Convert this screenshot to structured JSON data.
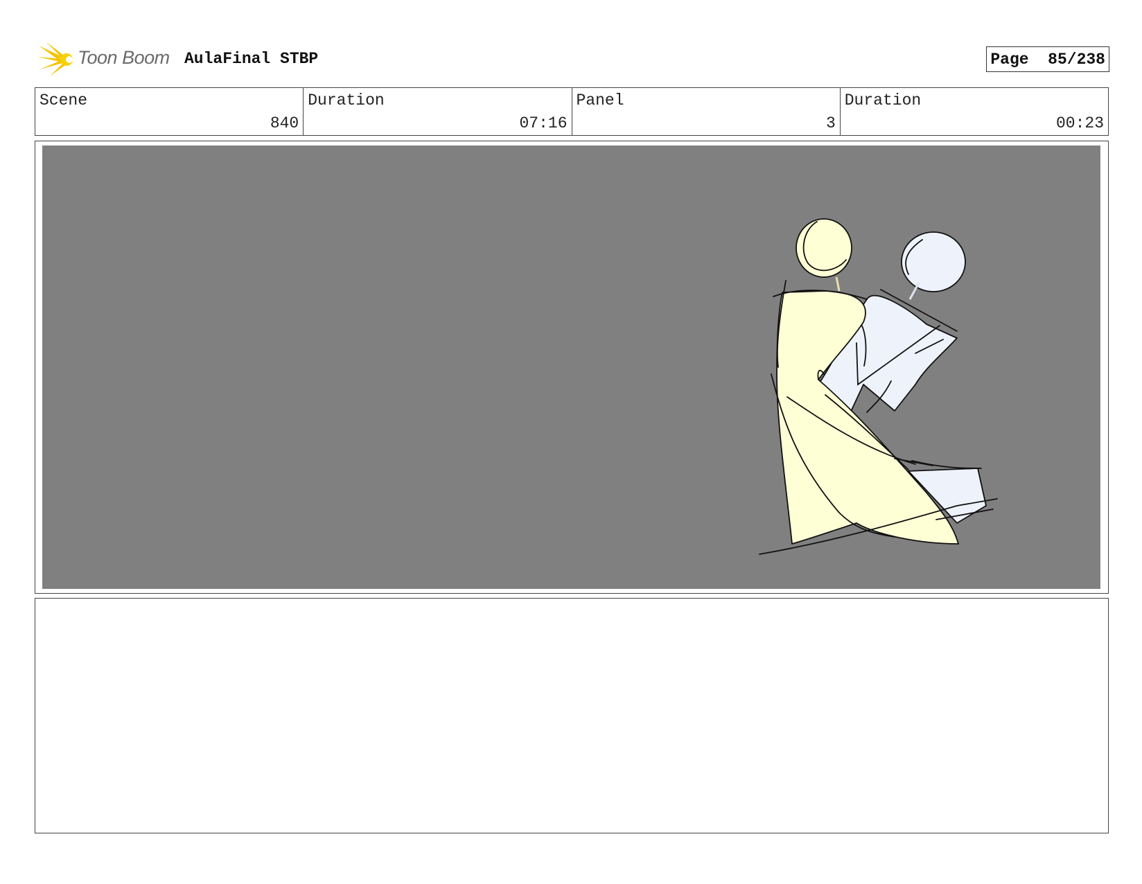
{
  "header": {
    "logo_text": "Toon Boom",
    "project_title": "AulaFinal STBP",
    "page_label": "Page",
    "page_value": "85/238"
  },
  "info": {
    "scene_label": "Scene",
    "scene_value": "840",
    "scene_duration_label": "Duration",
    "scene_duration_value": "07:16",
    "panel_label": "Panel",
    "panel_value": "3",
    "panel_duration_label": "Duration",
    "panel_duration_value": "00:23"
  },
  "panel": {
    "background_color": "#808080",
    "figure_colors": {
      "yellow": "#ffffd6",
      "blue": "#eef2fb",
      "line": "#111111"
    }
  },
  "notes": {
    "text": ""
  }
}
